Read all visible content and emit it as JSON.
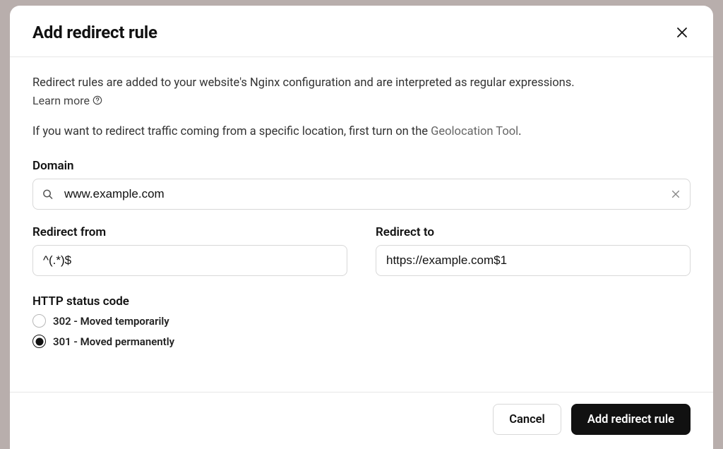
{
  "modal": {
    "title": "Add redirect rule",
    "description": "Redirect rules are added to your website's Nginx configuration and are interpreted as regular expressions.",
    "learn_more": "Learn more",
    "geolocation_pre": "If you want to redirect traffic coming from a specific location, first turn on the ",
    "geolocation_link": "Geolocation Tool",
    "geolocation_post": "."
  },
  "form": {
    "domain": {
      "label": "Domain",
      "value": "www.example.com"
    },
    "redirect_from": {
      "label": "Redirect from",
      "value": "^(.*)$"
    },
    "redirect_to": {
      "label": "Redirect to",
      "value": "https://example.com$1"
    },
    "http_status": {
      "label": "HTTP status code",
      "options": [
        {
          "label": "302 - Moved temporarily",
          "selected": false
        },
        {
          "label": "301 - Moved permanently",
          "selected": true
        }
      ]
    }
  },
  "footer": {
    "cancel": "Cancel",
    "submit": "Add redirect rule"
  }
}
